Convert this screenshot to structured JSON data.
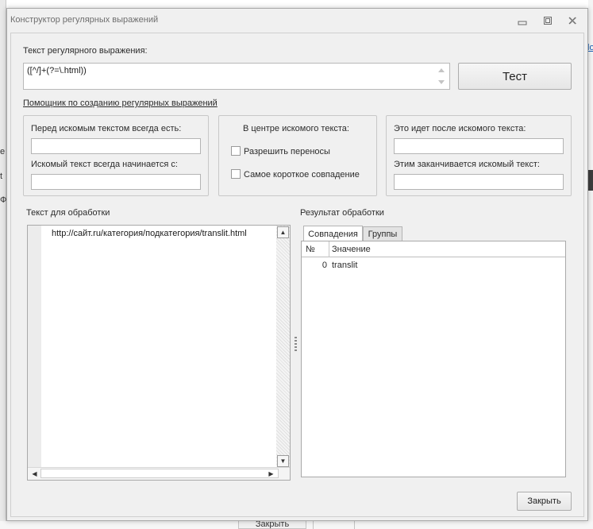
{
  "background": {
    "link_fragment": "lo",
    "frag_e": "e",
    "frag_t": "t",
    "frag_p": "Ф",
    "close_label": "Закрыть"
  },
  "window": {
    "title": "Конструктор регулярных выражений",
    "buttons": {
      "minimize": "minimize",
      "maximize": "maximize",
      "close": "close"
    }
  },
  "regex": {
    "label": "Текст регулярного выражения:",
    "value": "([^/]+(?=\\.html))"
  },
  "test_button": "Тест",
  "helper_link": "Помощник по созданию регулярных выражений",
  "helper": {
    "before": {
      "label": "Перед искомым текстом всегда есть:",
      "value": "",
      "starts_label": "Искомый текст всегда начинается с:",
      "starts_value": ""
    },
    "center": {
      "label": "В центре искомого текста:",
      "allow_wrap": {
        "label": "Разрешить переносы",
        "checked": false
      },
      "shortest": {
        "label": "Самое короткое совпадение",
        "checked": false
      }
    },
    "after": {
      "label": "Это идет после искомого текста:",
      "value": "",
      "ends_label": "Этим заканчивается искомый текст:",
      "ends_value": ""
    }
  },
  "input": {
    "label": "Текст для обработки",
    "text": "http://сайт.ru/категория/подкатегория/translit.html"
  },
  "result": {
    "label": "Результат обработки",
    "tabs": [
      {
        "label": "Совпадения",
        "active": true
      },
      {
        "label": "Группы",
        "active": false
      }
    ],
    "columns": [
      "№",
      "Значение"
    ],
    "rows": [
      {
        "num": "0",
        "value": "translit"
      }
    ]
  },
  "close_button": "Закрыть"
}
